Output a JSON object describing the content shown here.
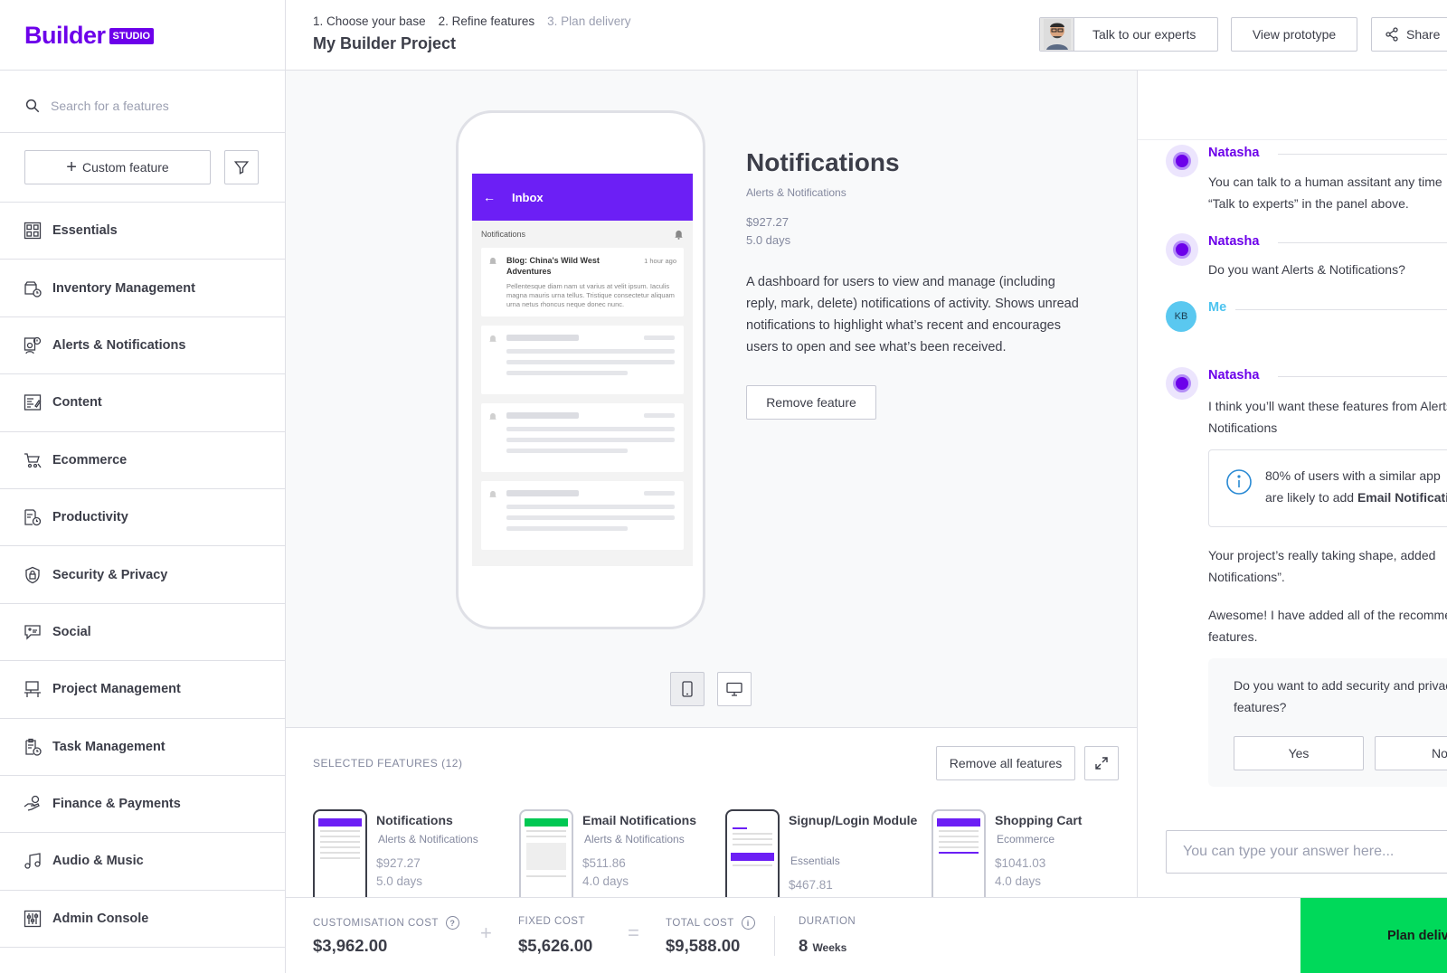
{
  "logo": {
    "brand": "Builder",
    "badge": "STUDIO"
  },
  "colors": {
    "accent": "#6c00ea",
    "cta": "#00d95a",
    "me": "#4cc3ef"
  },
  "search": {
    "placeholder": "Search for a features"
  },
  "sidebar": {
    "custom_feature": "Custom feature",
    "categories": [
      {
        "label": "Essentials",
        "icon": "grid-icon"
      },
      {
        "label": "Inventory Management",
        "icon": "box-clock-icon"
      },
      {
        "label": "Alerts & Notifications",
        "icon": "alert-person-icon"
      },
      {
        "label": "Content",
        "icon": "edit-doc-icon"
      },
      {
        "label": "Ecommerce",
        "icon": "cart-icon"
      },
      {
        "label": "Productivity",
        "icon": "doc-clock-icon"
      },
      {
        "label": "Security & Privacy",
        "icon": "shield-lock-icon"
      },
      {
        "label": "Social",
        "icon": "chat-face-icon"
      },
      {
        "label": "Project Management",
        "icon": "desk-icon"
      },
      {
        "label": "Task Management",
        "icon": "clipboard-clock-icon"
      },
      {
        "label": "Finance & Payments",
        "icon": "hand-coin-icon"
      },
      {
        "label": "Audio & Music",
        "icon": "music-note-icon"
      },
      {
        "label": "Admin Console",
        "icon": "sliders-icon"
      }
    ]
  },
  "header": {
    "steps": [
      "1. Choose your base",
      "2. Refine features",
      "3. Plan delivery"
    ],
    "project_title": "My Builder Project",
    "talk_experts": "Talk to our experts",
    "view_prototype": "View prototype",
    "share": "Share"
  },
  "preview": {
    "inbox_title": "Inbox",
    "notifications_label": "Notifications",
    "card_title": "Blog: China's Wild West Adventures",
    "card_time": "1 hour ago",
    "card_body": "Pellentesque diam nam ut varius at velit ipsum. Iaculis magna mauris urna tellus. Tristique consectetur aliquam urna netus rhoncus neque donec nunc."
  },
  "feature": {
    "title": "Notifications",
    "category": "Alerts & Notifications",
    "price": "$927.27",
    "days": "5.0 days",
    "description": "A dashboard for users to view and manage (including reply, mark, delete) notifications of activity. Shows unread notifications to highlight what’s recent and encourages users to open and see what’s been received.",
    "remove_label": "Remove feature"
  },
  "selected": {
    "label": "SELECTED FEATURES (12)",
    "remove_all": "Remove all features",
    "items": [
      {
        "name": "Notifications",
        "category": "Alerts & Notifications",
        "price": "$927.27",
        "days": "5.0 days"
      },
      {
        "name": "Email Notifications",
        "category": "Alerts & Notifications",
        "price": "$511.86",
        "days": "4.0 days"
      },
      {
        "name": "Signup/Login Module",
        "category": "Essentials",
        "price": "$467.81",
        "days": ""
      },
      {
        "name": "Shopping Cart",
        "category": "Ecommerce",
        "price": "$1041.03",
        "days": "4.0 days"
      }
    ]
  },
  "footer": {
    "custom_label": "CUSTOMISATION COST",
    "custom_value": "$3,962.00",
    "plus": "+",
    "fixed_label": "FIXED COST",
    "fixed_value": "$5,626.00",
    "equals": "=",
    "total_label": "TOTAL COST",
    "total_value": "$9,588.00",
    "duration_label": "DURATION",
    "duration_value": "8",
    "duration_unit": "Weeks",
    "plan_label": "Plan delivery"
  },
  "chat": {
    "bot_name": "Natasha",
    "me_name": "Me",
    "me_initials": "KB",
    "msg1_l1": "You can talk to a human assitant any time",
    "msg1_l2": "“Talk to experts” in the panel above.",
    "msg2": "Do you want Alerts & Notifications?",
    "msg3_l1": "I think you’ll want these features from Alerts &",
    "msg3_l2": "Notifications",
    "info_l1": "80% of users with a similar app",
    "info_l2_pre": "are likely to add ",
    "info_l2_bold": "Email Notifications",
    "msg4_l1": "Your project’s really taking shape, added",
    "msg4_l2": "Notifications”.",
    "msg5_l1": "Awesome! I have added all of the recommended",
    "msg5_l2": "features.",
    "q_l1": "Do you want to add security and privacy",
    "q_l2": "features?",
    "yes": "Yes",
    "no": "No",
    "answer_placeholder": "You can type your answer here..."
  }
}
